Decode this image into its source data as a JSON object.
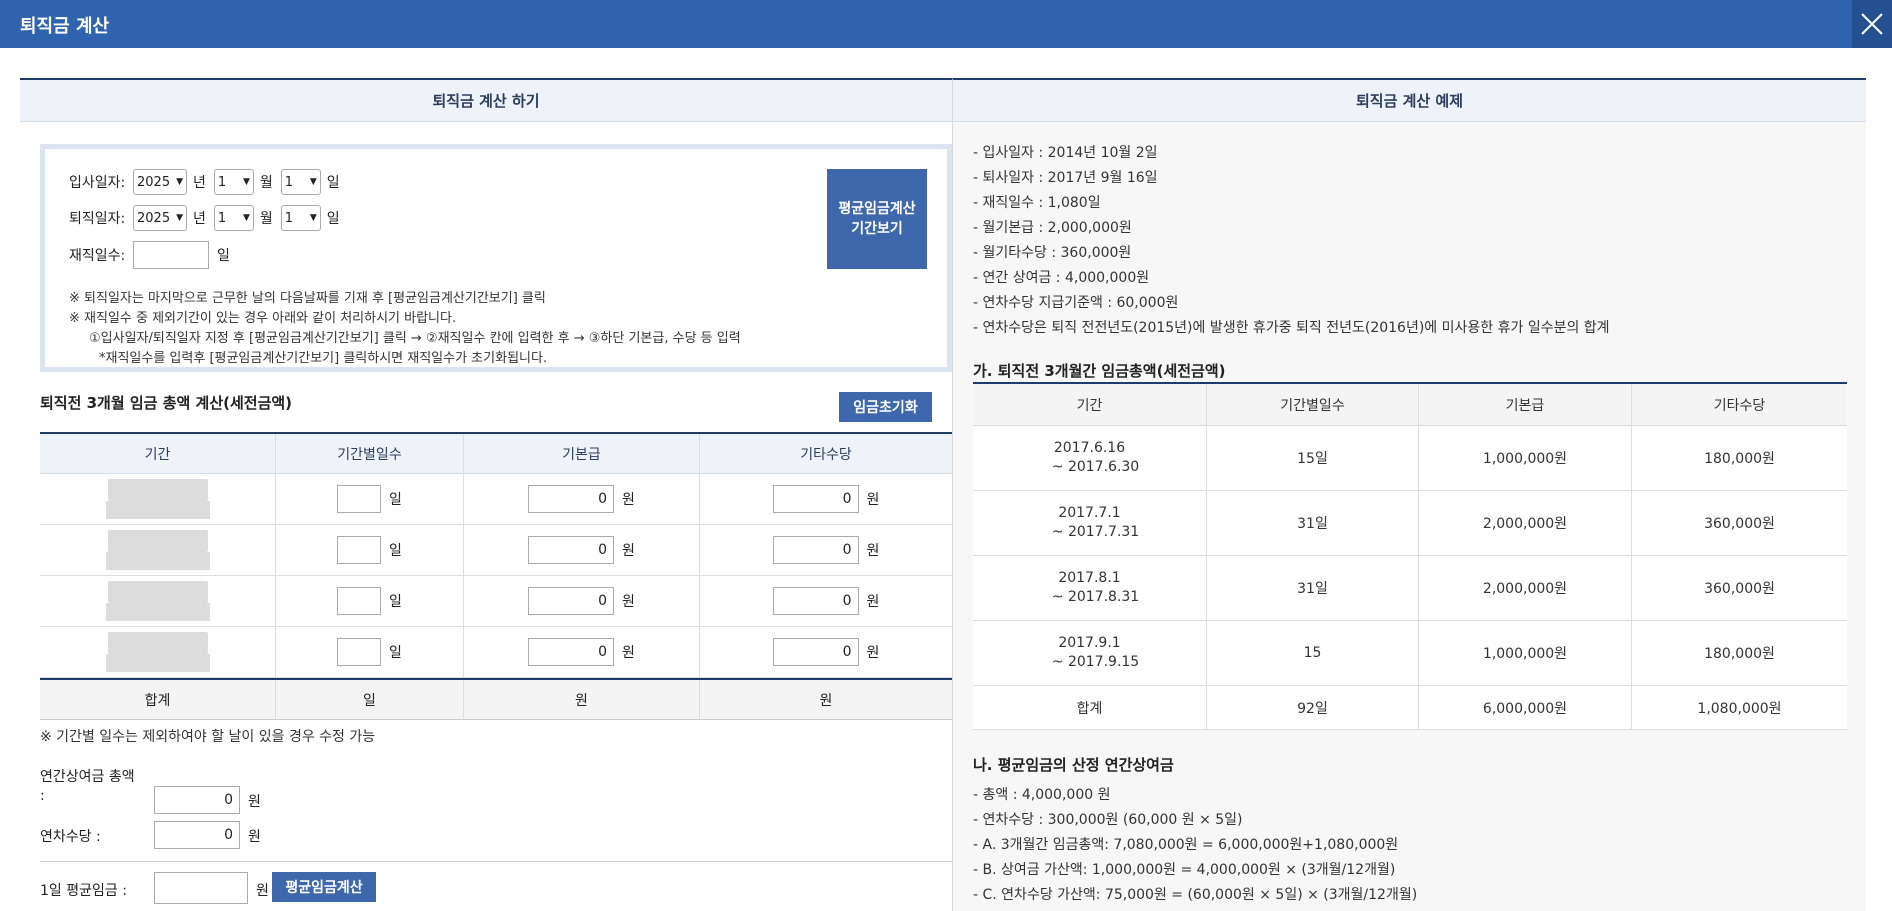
{
  "header": {
    "title": "퇴직금 계산"
  },
  "left": {
    "panel_title": "퇴직금 계산 하기",
    "join_label": "입사일자:",
    "leave_label": "퇴직일자:",
    "days_label": "재직일수:",
    "year_value": "2025",
    "month_value": "1",
    "day_value": "1",
    "unit_year": "년",
    "unit_month": "월",
    "unit_day": "일",
    "period_button": [
      "평균임금계산",
      "기간보기"
    ],
    "notes": [
      "※ 퇴직일자는 마지막으로 근무한 날의 다음날짜를 기재 후 [평균임금계산기간보기] 클릭",
      "※ 재직일수 중 제외기간이 있는 경우 아래와 같이 처리하시기 바랍니다.",
      "①입사일자/퇴직일자 지정 후 [평균임금계산기간보기] 클릭 → ②재직일수 칸에 입력한 후 → ③하단 기본급, 수당 등 입력",
      "*재직일수를 입력후 [평균임금계산기간보기] 클릭하시면 재직일수가 초기화됩니다."
    ],
    "section_title": "퇴직전 3개월 임금 총액 계산(세전금액)",
    "reset_button": "임금초기화",
    "table_headers": [
      "기간",
      "기간별일수",
      "기본급",
      "기타수당"
    ],
    "row_value": "0",
    "unit_won": "원",
    "sum_label": "합계",
    "sum_days_unit": "일",
    "sum_won": "원",
    "days_note": "※ 기간별 일수는 제외하여야 할 날이 있을 경우 수정 가능",
    "bonus_label_1": "연간상여금 총액",
    "bonus_label_2": ":",
    "bonus_value": "0",
    "leave_allow_label": "연차수당 :",
    "leave_allow_value": "0",
    "avg_wage_label": "1일 평균임금 :",
    "avg_button": "평균임금계산"
  },
  "right": {
    "panel_title": "퇴직금 계산 예제",
    "facts": [
      "- 입사일자 : 2014년 10월 2일",
      "- 퇴사일자 : 2017년 9월 16일",
      "- 재직일수 : 1,080일",
      "- 월기본급 : 2,000,000원",
      "- 월기타수당 : 360,000원",
      "- 연간 상여금 : 4,000,000원",
      "- 연차수당 지급기준액 : 60,000원",
      "- 연차수당은 퇴직 전전년도(2015년)에 발생한 휴가중 퇴직 전년도(2016년)에 미사용한 휴가 일수분의 합계"
    ],
    "section_a": "가. 퇴직전 3개월간 임금총액(세전금액)",
    "table_headers": [
      "기간",
      "기간별일수",
      "기본급",
      "기타수당"
    ],
    "rows": [
      {
        "from": "2017.6.16",
        "to": "~ 2017.6.30",
        "days": "15일",
        "base": "1,000,000원",
        "other": "180,000원"
      },
      {
        "from": "2017.7.1",
        "to": "~ 2017.7.31",
        "days": "31일",
        "base": "2,000,000원",
        "other": "360,000원"
      },
      {
        "from": "2017.8.1",
        "to": "~ 2017.8.31",
        "days": "31일",
        "base": "2,000,000원",
        "other": "360,000원"
      },
      {
        "from": "2017.9.1",
        "to": "~ 2017.9.15",
        "days": "15",
        "base": "1,000,000원",
        "other": "180,000원"
      }
    ],
    "sum": {
      "label": "합계",
      "days": "92일",
      "base": "6,000,000원",
      "other": "1,080,000원"
    },
    "section_b": "나. 평균임금의 산정 연간상여금",
    "b_items": [
      "- 총액 : 4,000,000 원",
      "- 연차수당 : 300,000원 (60,000 원 × 5일)",
      "- A. 3개월간 임금총액: 7,080,000원 = 6,000,000원+1,080,000원",
      "- B. 상여금 가산액: 1,000,000원 = 4,000,000원 × (3개월/12개월)",
      "- C. 연차수당 가산액: 75,000원 = (60,000원 × 5일) × (3개월/12개월)"
    ]
  }
}
